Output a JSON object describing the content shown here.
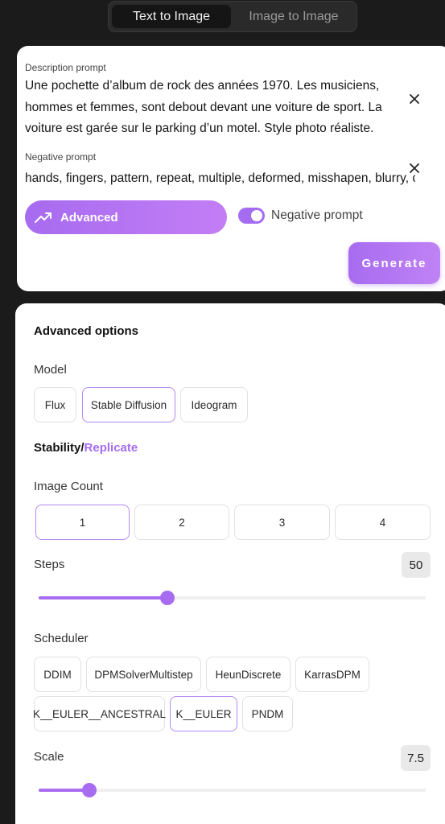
{
  "tabs": [
    {
      "label": "Text to Image",
      "active": true
    },
    {
      "label": "Image to Image",
      "active": false
    }
  ],
  "prompt": {
    "description_label": "Description prompt",
    "description_value": "Une pochette d’album de rock des années 1970. Les musiciens, hommes et femmes, sont debout devant une voiture de sport. La voiture est garée sur le parking d’un motel. Style photo réaliste.",
    "negative_label": "Negative prompt",
    "negative_value": "hands, fingers, pattern, repeat, multiple, deformed, misshapen, blurry, crowd",
    "advanced_label": "Advanced",
    "negative_toggle_label": "Negative prompt",
    "negative_toggle_on": true,
    "generate_label": "Generate"
  },
  "advanced": {
    "title": "Advanced options",
    "model_label": "Model",
    "models": [
      "Flux",
      "Stable Diffusion",
      "Ideogram"
    ],
    "selected_model": "Stable Diffusion",
    "provider_primary": "Stability",
    "provider_separator": "/",
    "provider_secondary": "Replicate",
    "image_count_label": "Image Count",
    "image_counts": [
      "1",
      "2",
      "3",
      "4"
    ],
    "selected_count": "1",
    "steps_label": "Steps",
    "steps_value": "50",
    "steps_fraction": 0.333,
    "scheduler_label": "Scheduler",
    "schedulers_row1": [
      "DDIM",
      "DPMSolverMultistep",
      "HeunDiscrete",
      "KarrasDPM"
    ],
    "schedulers_row2": [
      "K__EULER__ANCESTRAL",
      "K__EULER",
      "PNDM"
    ],
    "selected_scheduler": "K__EULER",
    "scale_label": "Scale",
    "scale_value": "7.5",
    "scale_fraction": 0.13
  },
  "colors": {
    "accent": "#a76cf0",
    "background": "#1b1b1b"
  }
}
